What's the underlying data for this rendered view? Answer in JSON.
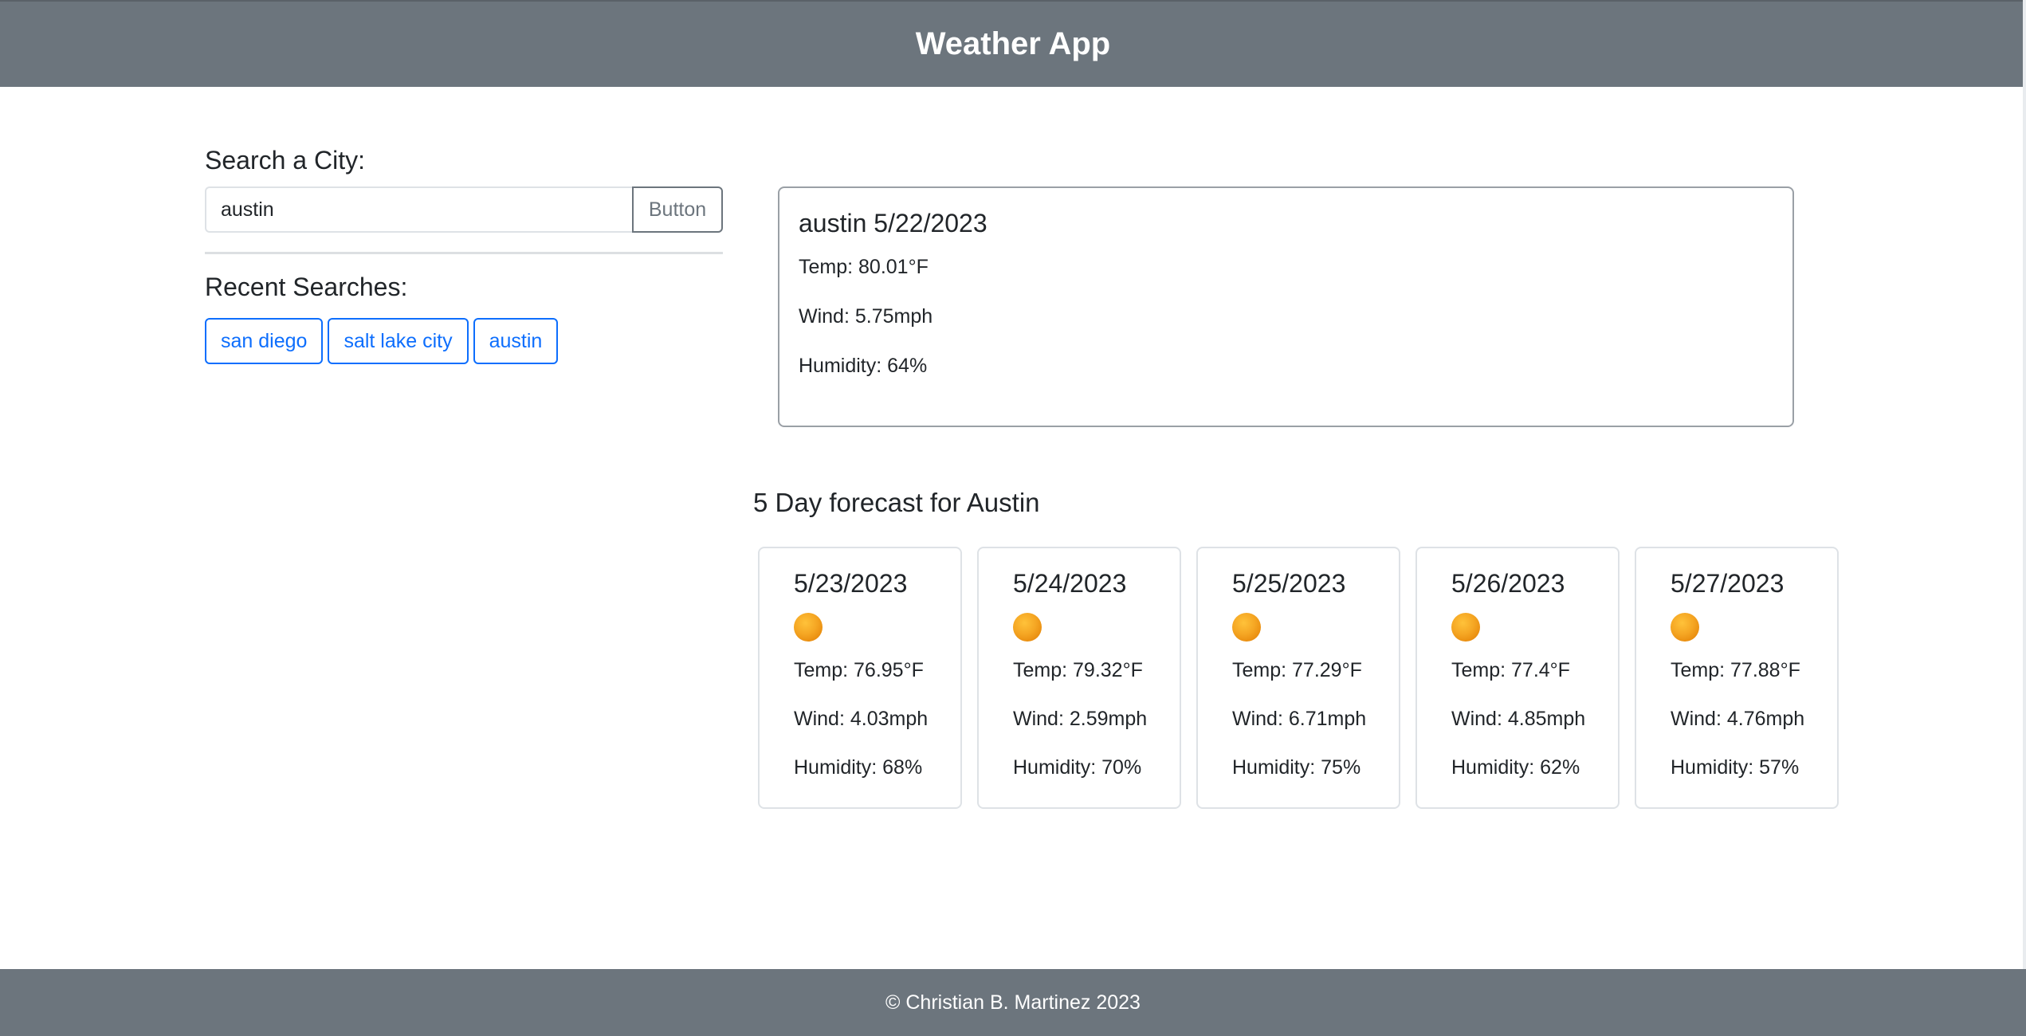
{
  "header": {
    "title": "Weather App"
  },
  "search": {
    "label": "Search a City:",
    "value": "austin",
    "button_label": "Button"
  },
  "recent": {
    "label": "Recent Searches:",
    "items": [
      "san diego",
      "salt lake city",
      "austin"
    ]
  },
  "current": {
    "title": "austin 5/22/2023",
    "temp": "Temp: 80.01°F",
    "wind": "Wind: 5.75mph",
    "humidity": "Humidity: 64%"
  },
  "forecast": {
    "title": "5 Day forecast for Austin",
    "icon": "sun-icon",
    "days": [
      {
        "date": "5/23/2023",
        "temp": "Temp: 76.95°F",
        "wind": "Wind: 4.03mph",
        "humidity": "Humidity: 68%"
      },
      {
        "date": "5/24/2023",
        "temp": "Temp: 79.32°F",
        "wind": "Wind: 2.59mph",
        "humidity": "Humidity: 70%"
      },
      {
        "date": "5/25/2023",
        "temp": "Temp: 77.29°F",
        "wind": "Wind: 6.71mph",
        "humidity": "Humidity: 75%"
      },
      {
        "date": "5/26/2023",
        "temp": "Temp: 77.4°F",
        "wind": "Wind: 4.85mph",
        "humidity": "Humidity: 62%"
      },
      {
        "date": "5/27/2023",
        "temp": "Temp: 77.88°F",
        "wind": "Wind: 4.76mph",
        "humidity": "Humidity: 57%"
      }
    ]
  },
  "footer": {
    "text": "© Christian B. Martinez 2023"
  },
  "colors": {
    "header_bg": "#6c757d",
    "link_blue": "#0d6efd",
    "sun": "#f5a623"
  }
}
